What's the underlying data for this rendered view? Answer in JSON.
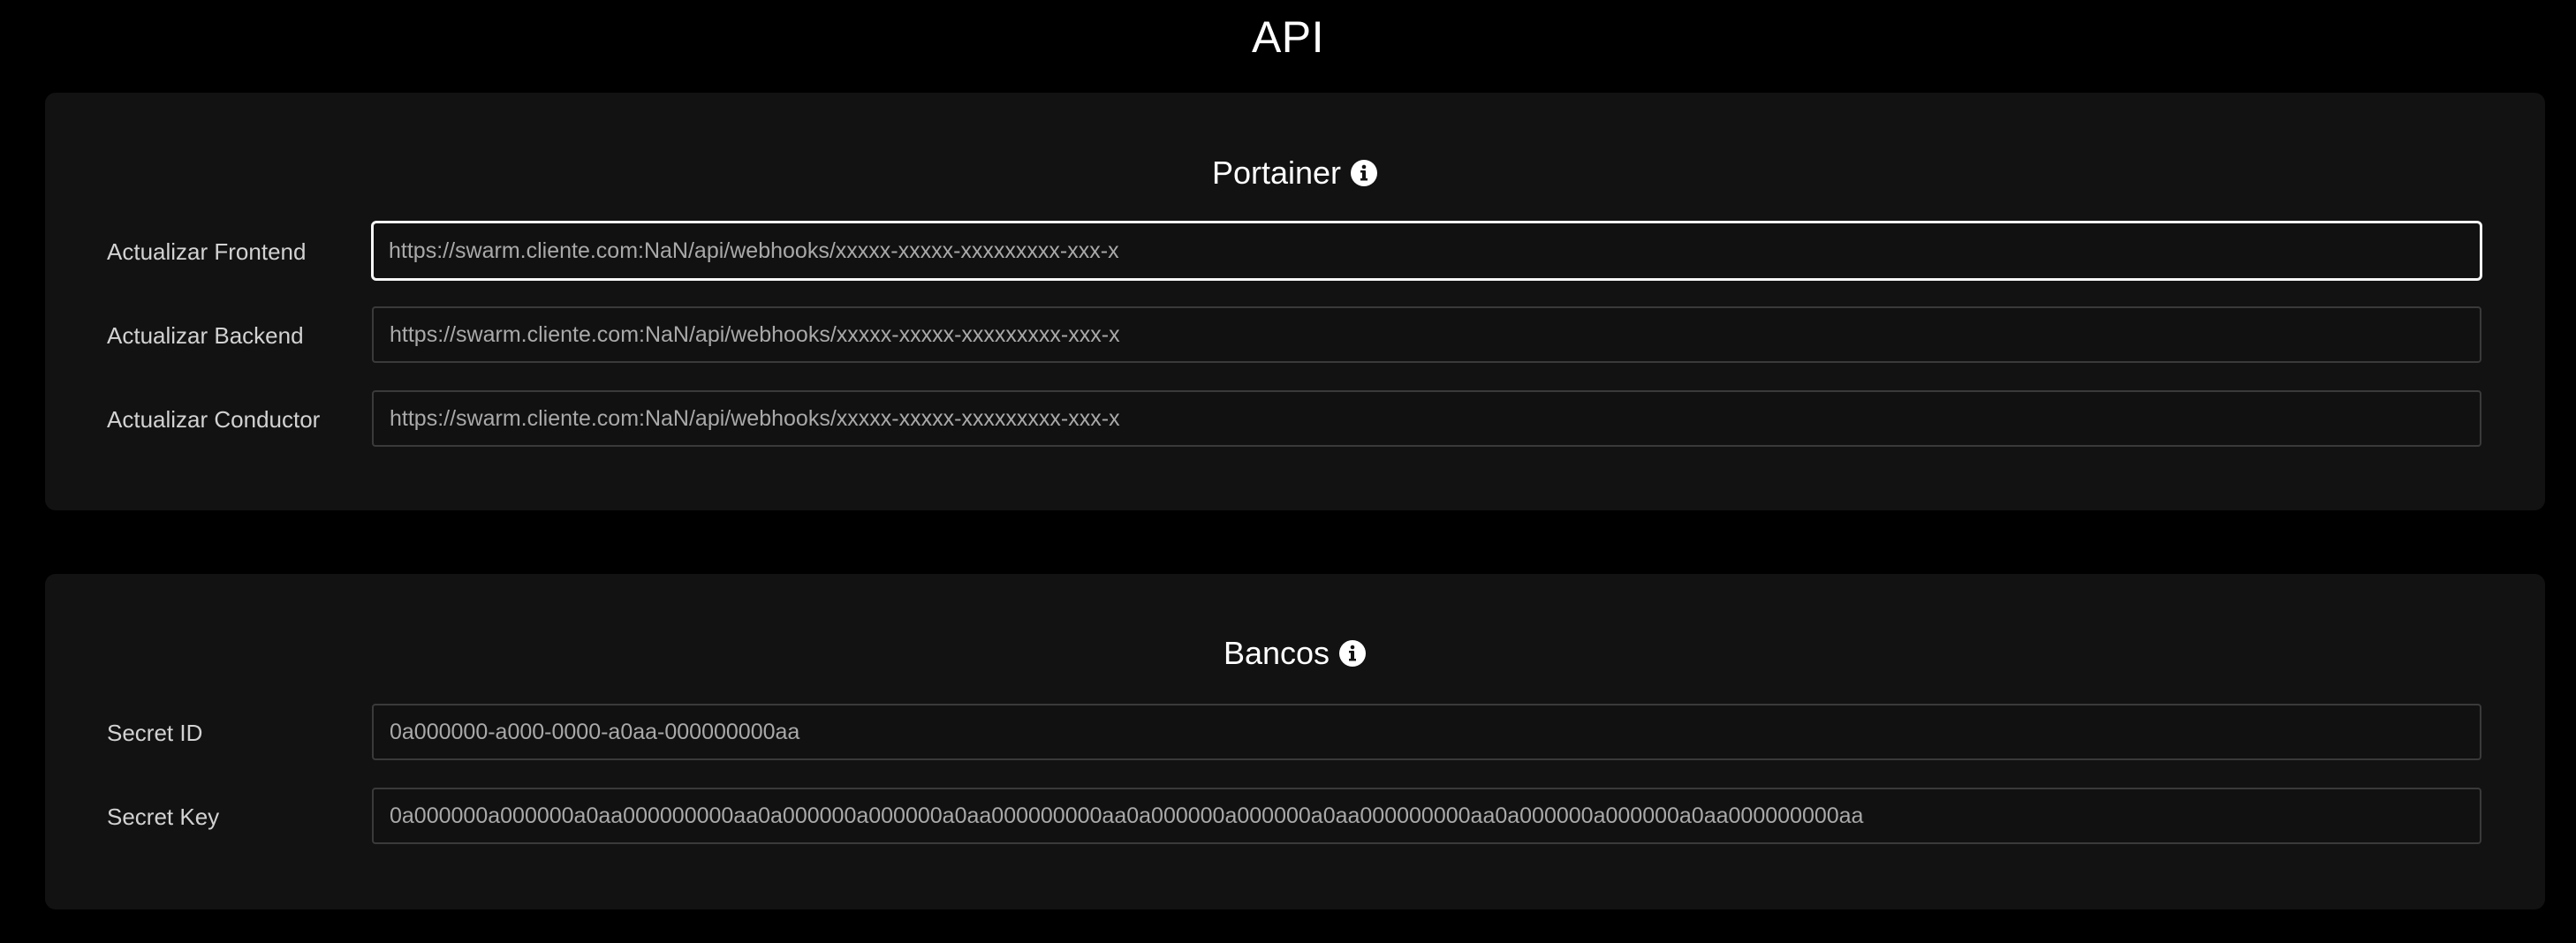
{
  "page": {
    "title": "API"
  },
  "portainer": {
    "title": "Portainer",
    "info_icon": "info-icon",
    "fields": [
      {
        "label": "Actualizar Frontend",
        "value": "https://swarm.cliente.com:NaN/api/webhooks/xxxxx-xxxxx-xxxxxxxxx-xxx-x"
      },
      {
        "label": "Actualizar Backend",
        "value": "https://swarm.cliente.com:NaN/api/webhooks/xxxxx-xxxxx-xxxxxxxxx-xxx-x"
      },
      {
        "label": "Actualizar Conductor",
        "value": "https://swarm.cliente.com:NaN/api/webhooks/xxxxx-xxxxx-xxxxxxxxx-xxx-x"
      }
    ]
  },
  "bancos": {
    "title": "Bancos",
    "info_icon": "info-icon",
    "fields": [
      {
        "label": "Secret ID",
        "value": "0a000000-a000-0000-a0aa-000000000aa"
      },
      {
        "label": "Secret Key",
        "value": "0a000000a000000a0aa000000000aa0a000000a000000a0aa000000000aa0a000000a000000a0aa000000000aa0a000000a000000a0aa000000000aa"
      }
    ]
  },
  "colors": {
    "background": "#000000",
    "panel": "#121212",
    "input_border": "#3a3a3a",
    "input_focus_border": "#f5f5f5",
    "label_text": "#d2d2d2",
    "input_text": "#a9a9a9"
  }
}
